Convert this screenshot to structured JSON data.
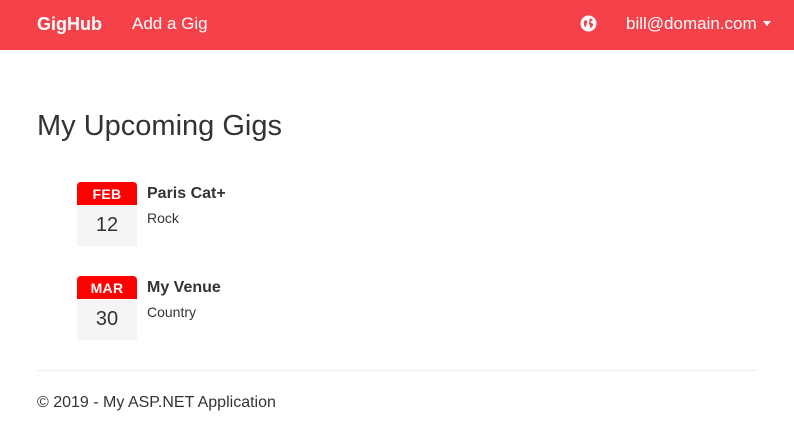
{
  "navbar": {
    "brand": "GigHub",
    "links": [
      {
        "label": "Add a Gig"
      }
    ],
    "globe_icon": "globe-icon",
    "user": {
      "label": "bill@domain.com",
      "icon": "caret-down-icon"
    },
    "background_color": "#f5424a"
  },
  "main": {
    "title": "My Upcoming Gigs",
    "gigs": [
      {
        "month": "FEB",
        "day": "12",
        "venue": "Paris Cat+",
        "genre": "Rock"
      },
      {
        "month": "MAR",
        "day": "30",
        "venue": "My Venue",
        "genre": "Country"
      }
    ],
    "calendar_month_color": "#ff0000"
  },
  "footer": {
    "text": "© 2019 - My ASP.NET Application"
  }
}
